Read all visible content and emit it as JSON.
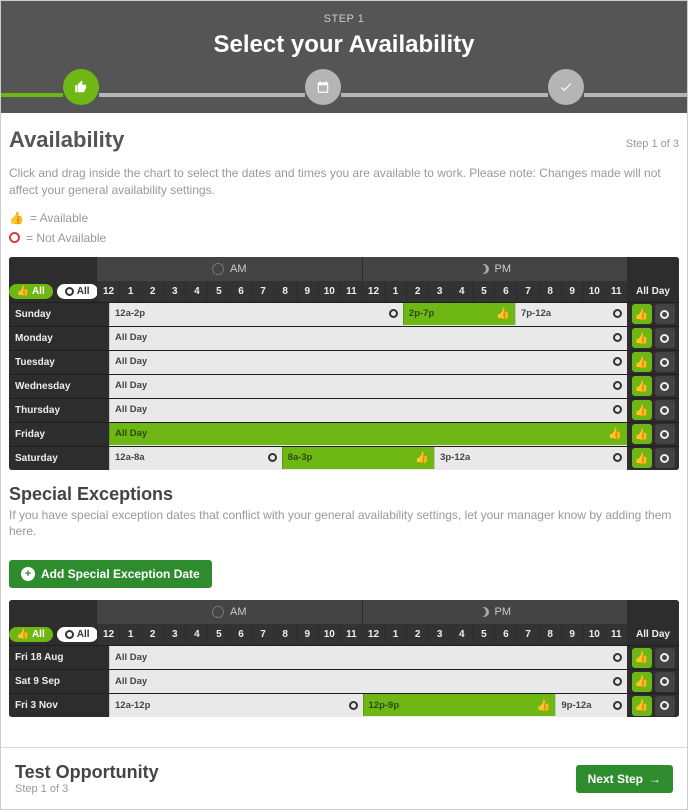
{
  "hero": {
    "step_label": "STEP 1",
    "title": "Select your Availability"
  },
  "stepper": {
    "icons": [
      "thumb-up",
      "calendar",
      "check"
    ]
  },
  "page": {
    "heading": "Availability",
    "step_of": "Step 1 of 3",
    "help": "Click and drag inside the chart to select the dates and times you are available to work. Please note: Changes made will not affect your general availability settings."
  },
  "legend": {
    "available": "= Available",
    "not_available": "= Not Available"
  },
  "grid": {
    "am": "AM",
    "pm": "PM",
    "hours": [
      "12",
      "1",
      "2",
      "3",
      "4",
      "5",
      "6",
      "7",
      "8",
      "9",
      "10",
      "11",
      "12",
      "1",
      "2",
      "3",
      "4",
      "5",
      "6",
      "7",
      "8",
      "9",
      "10",
      "11"
    ],
    "all_day": "All Day",
    "filter_all": "All",
    "days": [
      {
        "label": "Sunday",
        "bars": [
          {
            "type": "unavail",
            "text": "12a-2p",
            "span": 14
          },
          {
            "type": "avail",
            "text": "2p-7p",
            "span": 5
          },
          {
            "type": "unavail",
            "text": "7p-12a",
            "span": 5
          }
        ]
      },
      {
        "label": "Monday",
        "bars": [
          {
            "type": "unavail",
            "text": "All Day",
            "span": 24
          }
        ]
      },
      {
        "label": "Tuesday",
        "bars": [
          {
            "type": "unavail",
            "text": "All Day",
            "span": 24
          }
        ]
      },
      {
        "label": "Wednesday",
        "bars": [
          {
            "type": "unavail",
            "text": "All Day",
            "span": 24
          }
        ]
      },
      {
        "label": "Thursday",
        "bars": [
          {
            "type": "unavail",
            "text": "All Day",
            "span": 24
          }
        ]
      },
      {
        "label": "Friday",
        "bars": [
          {
            "type": "avail",
            "text": "All Day",
            "span": 24
          }
        ]
      },
      {
        "label": "Saturday",
        "bars": [
          {
            "type": "unavail",
            "text": "12a-8a",
            "span": 8
          },
          {
            "type": "avail",
            "text": "8a-3p",
            "span": 7
          },
          {
            "type": "unavail",
            "text": "3p-12a",
            "span": 9
          }
        ]
      }
    ]
  },
  "special": {
    "heading": "Special Exceptions",
    "help": "If you have special exception dates that conflict with your general availability settings, let your manager know by adding them here.",
    "add_btn": "Add Special Exception Date",
    "days": [
      {
        "label": "Fri 18 Aug",
        "bars": [
          {
            "type": "unavail",
            "text": "All Day",
            "span": 24
          }
        ]
      },
      {
        "label": "Sat 9 Sep",
        "bars": [
          {
            "type": "unavail",
            "text": "All Day",
            "span": 24
          }
        ]
      },
      {
        "label": "Fri 3 Nov",
        "bars": [
          {
            "type": "unavail",
            "text": "12a-12p",
            "span": 12
          },
          {
            "type": "avail",
            "text": "12p-9p",
            "span": 9
          },
          {
            "type": "unavail",
            "text": "9p-12a",
            "span": 3
          }
        ]
      }
    ]
  },
  "footer": {
    "title": "Test Opportunity",
    "sub": "Step 1 of 3",
    "next": "Next Step"
  }
}
